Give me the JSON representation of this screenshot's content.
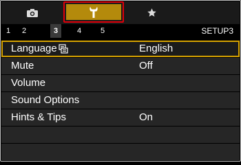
{
  "category_tabs": [
    {
      "icon": "camera-icon"
    },
    {
      "icon": "wrench-icon",
      "selected": true
    },
    {
      "icon": "star-icon"
    }
  ],
  "sub_tabs": [
    "1",
    "2",
    "3",
    "4",
    "5"
  ],
  "active_sub_tab": "3",
  "page_title": "SETUP3",
  "menu": [
    {
      "label": "Language",
      "value": "English",
      "has_icon": true
    },
    {
      "label": "Mute",
      "value": "Off"
    },
    {
      "label": "Volume",
      "value": ""
    },
    {
      "label": "Sound Options",
      "value": ""
    },
    {
      "label": "Hints & Tips",
      "value": "On"
    }
  ],
  "colors": {
    "selected_tab_fill": "#b48a0c",
    "selected_tab_border": "#e0000a",
    "row_highlight_border": "#d7a300",
    "row_fill": "#262626"
  }
}
